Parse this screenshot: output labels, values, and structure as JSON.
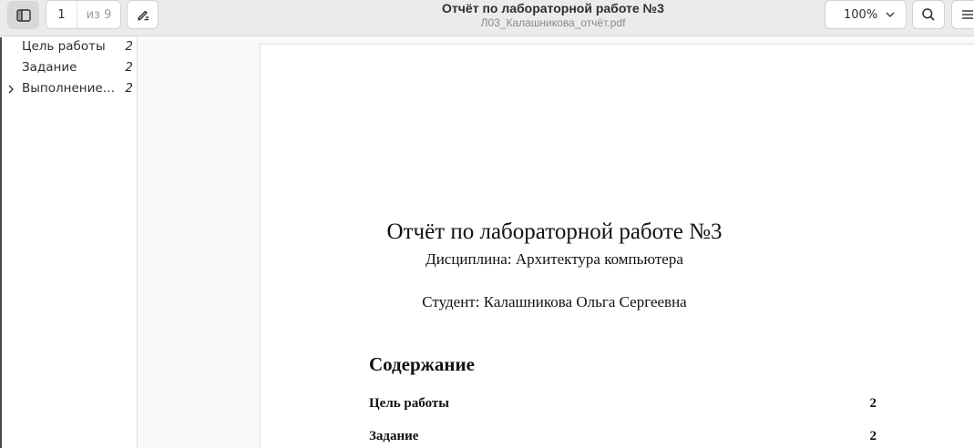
{
  "header": {
    "doc_title": "Отчёт по лабораторной работе №3",
    "file_name": "Л03_Калашникова_отчёт.pdf",
    "page_current": "1",
    "page_total": "из 9",
    "zoom": "100%"
  },
  "sidebar": {
    "items": [
      {
        "label": "Цель работы",
        "page": "2"
      },
      {
        "label": "Задание",
        "page": "2"
      },
      {
        "label": "Выполнение…",
        "page": "2"
      }
    ]
  },
  "page": {
    "title": "Отчёт по лабораторной работе №3",
    "discipline": "Дисциплина: Архитектура компьютера",
    "student": "Студент: Калашникова Ольга Сергеевна",
    "toc_title": "Содержание",
    "toc": [
      {
        "label": "Цель работы",
        "page": "2"
      },
      {
        "label": "Задание",
        "page": "2"
      }
    ]
  },
  "icons": {
    "sidebar_toggle": "sidebar-icon",
    "annotate": "pencil-icon",
    "zoom_dropdown": "chevron-down-icon",
    "search": "search-icon",
    "menu": "hamburger-menu-icon",
    "expander": "chevron-right-icon"
  }
}
